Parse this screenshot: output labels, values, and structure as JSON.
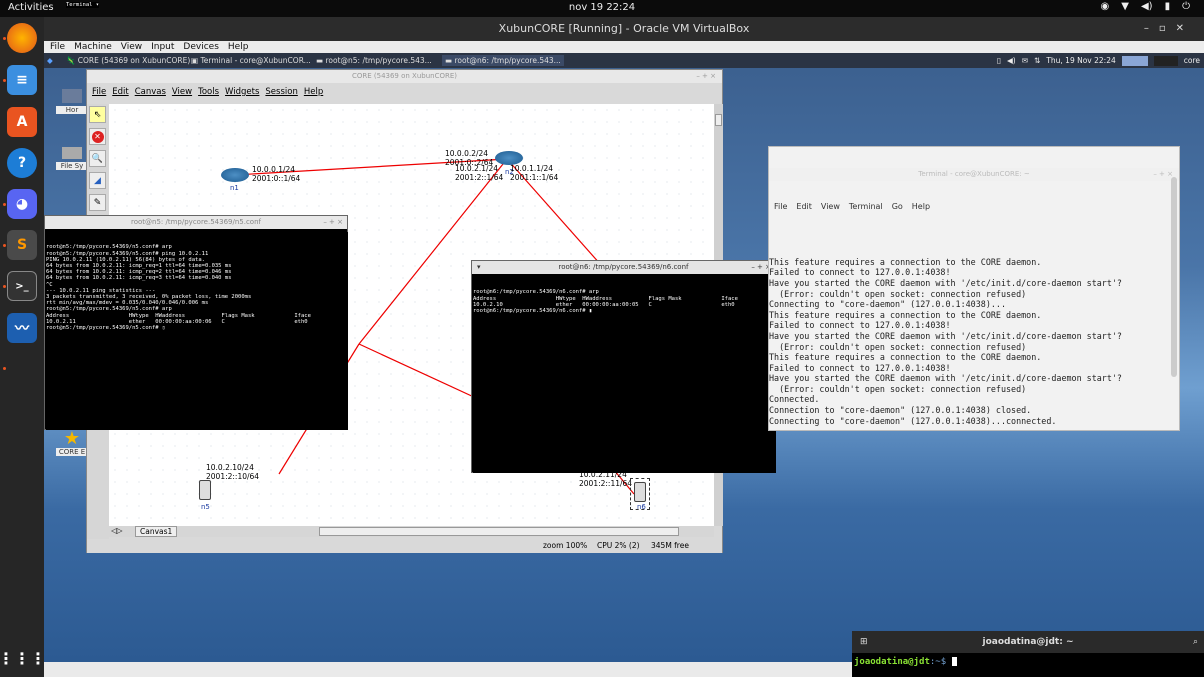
{
  "topbar": {
    "activities": "Activities",
    "app": "Terminal ▾",
    "clock": "nov 19  22:24"
  },
  "vbox": {
    "title": "XubunCORE [Running] - Oracle VM VirtualBox",
    "menu": [
      "File",
      "Machine",
      "View",
      "Input",
      "Devices",
      "Help"
    ]
  },
  "taskbar": {
    "items": [
      "CORE (54369 on XubunCORE)",
      "Terminal - core@XubunCOR...",
      "root@n5: /tmp/pycore.543...",
      "root@n6: /tmp/pycore.543..."
    ],
    "datetime": "Thu, 19 Nov  22:24",
    "user": "core"
  },
  "desktop": {
    "icons": [
      "Hor",
      "File Sy",
      "CORE E"
    ]
  },
  "core": {
    "title": "CORE (54369 on XubunCORE)",
    "menu": [
      "File",
      "Edit",
      "Canvas",
      "View",
      "Tools",
      "Widgets",
      "Session",
      "Help"
    ],
    "canvas_tab": "Canvas1",
    "status": {
      "zoom": "zoom 100%",
      "cpu": "CPU 2% (2)",
      "mem": "345M free"
    },
    "nodes": {
      "n1": {
        "name": "n1",
        "label": "10.0.0.1/24\n2001:0::1/64"
      },
      "n2": {
        "name": "n2",
        "label_top": "10.0.0.2/24\n2001:0::2/64",
        "label_left": "10.0.2.1/24\n2001:2::1/64",
        "label_right": "10.0.1.1/24\n2001:1::1/64"
      },
      "n5": {
        "name": "n5",
        "label": "10.0.2.10/24\n2001:2::10/64"
      },
      "n6": {
        "name": "n6",
        "label": "10.0.2.11/24\n2001:2::11/64"
      }
    }
  },
  "term_n5": {
    "title": "root@n5: /tmp/pycore.54369/n5.conf",
    "lines": [
      "root@n5:/tmp/pycore.54369/n5.conf# arp",
      "root@n5:/tmp/pycore.54369/n5.conf# ping 10.0.2.11",
      "PING 10.0.2.11 (10.0.2.11) 56(84) bytes of data.",
      "64 bytes from 10.0.2.11: icmp_req=1 ttl=64 time=0.035 ms",
      "64 bytes from 10.0.2.11: icmp_req=2 ttl=64 time=0.046 ms",
      "64 bytes from 10.0.2.11: icmp_req=3 ttl=64 time=0.040 ms",
      "^C",
      "--- 10.0.2.11 ping statistics ---",
      "3 packets transmitted, 3 received, 0% packet loss, time 2000ms",
      "rtt min/avg/max/mdev = 0.035/0.040/0.046/0.006 ms",
      "root@n5:/tmp/pycore.54369/n5.conf# arp",
      "Address                  HWtype  HWaddress           Flags Mask            Iface",
      "10.0.2.11                ether   00:00:00:aa:00:06   C                     eth0",
      "root@n5:/tmp/pycore.54369/n5.conf# ▯"
    ]
  },
  "term_n6": {
    "title": "root@n6: /tmp/pycore.54369/n6.conf",
    "lines": [
      "root@n6:/tmp/pycore.54369/n6.conf# arp",
      "Address                  HWtype  HWaddress           Flags Mask            Iface",
      "10.0.2.10                ether   00:00:00:aa:00:05   C                     eth0",
      "root@n6:/tmp/pycore.54369/n6.conf# ▮"
    ]
  },
  "daemon_term": {
    "title": "Terminal - core@XubunCORE: ~",
    "menu": [
      "File",
      "Edit",
      "View",
      "Terminal",
      "Go",
      "Help"
    ],
    "lines": [
      "This feature requires a connection to the CORE daemon.",
      "",
      "Failed to connect to 127.0.0.1:4038!",
      "",
      "Have you started the CORE daemon with '/etc/init.d/core-daemon start'?",
      "  (Error: couldn't open socket: connection refused)",
      "Connecting to \"core-daemon\" (127.0.0.1:4038)...",
      "This feature requires a connection to the CORE daemon.",
      "",
      "Failed to connect to 127.0.0.1:4038!",
      "",
      "Have you started the CORE daemon with '/etc/init.d/core-daemon start'?",
      "  (Error: couldn't open socket: connection refused)",
      "",
      "This feature requires a connection to the CORE daemon.",
      "",
      "Failed to connect to 127.0.0.1:4038!",
      "",
      "Have you started the CORE daemon with '/etc/init.d/core-daemon start'?",
      "  (Error: couldn't open socket: connection refused)",
      "Connected.",
      "Connection to \"core-daemon\" (127.0.0.1:4038) closed.",
      "Connecting to \"core-daemon\" (127.0.0.1:4038)...connected."
    ]
  },
  "host_term": {
    "title": "joaodatina@jdt: ~",
    "prompt_user": "joaodatina@jdt",
    "prompt_rest": ":~$ "
  }
}
